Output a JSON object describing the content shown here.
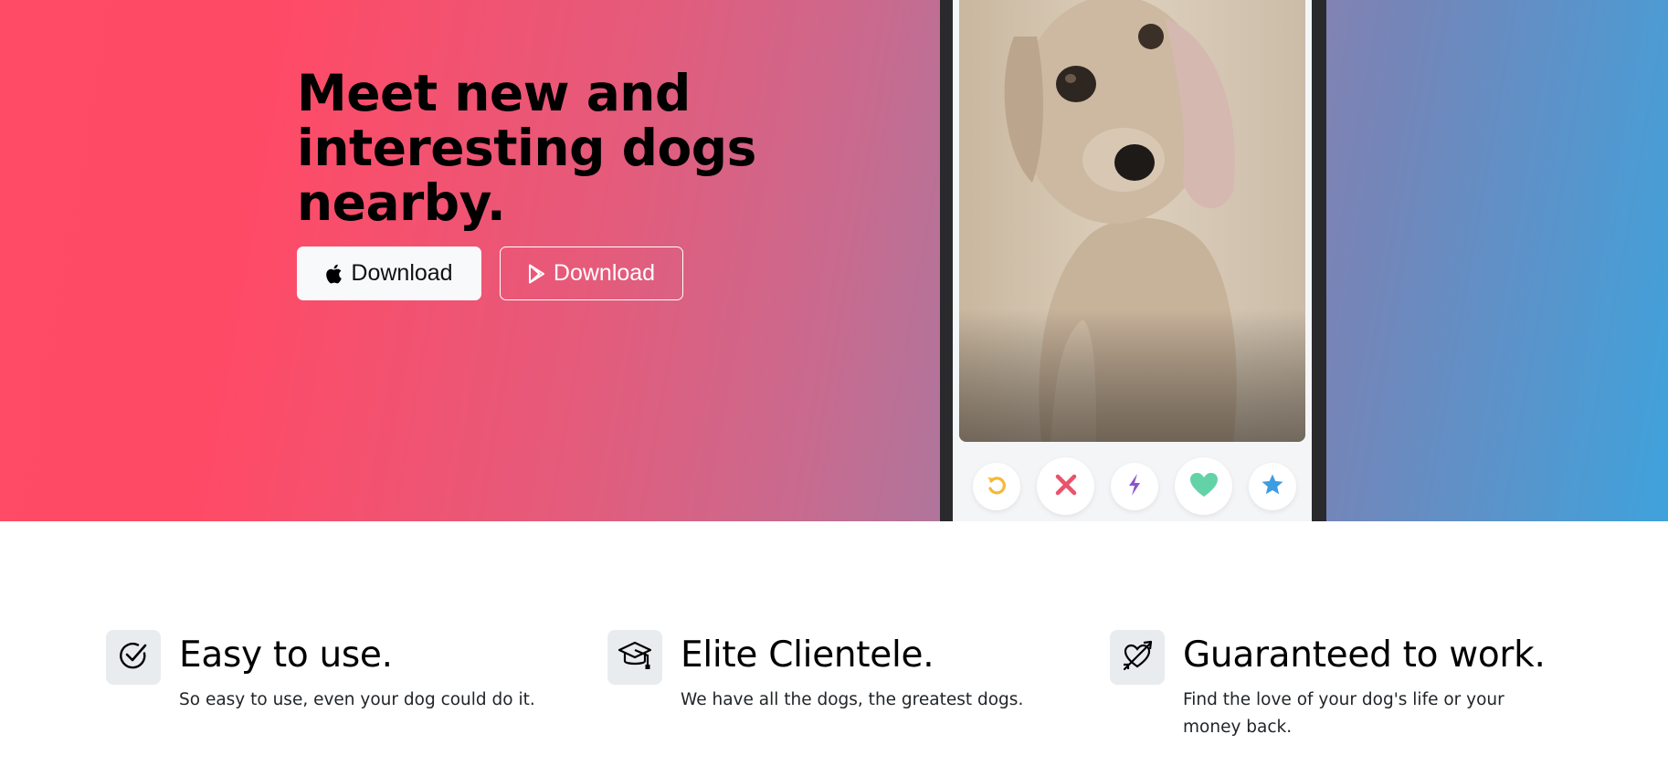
{
  "hero": {
    "headline": "Meet new and interesting dogs nearby.",
    "buttons": {
      "apple_label": "Download",
      "play_label": "Download"
    },
    "colors": {
      "gradient_start": "#ff4a66",
      "gradient_end": "#3fa2dc"
    }
  },
  "phone": {
    "actions": [
      {
        "icon": "undo-icon",
        "color": "#f5b935"
      },
      {
        "icon": "close-icon",
        "color": "#e8546b"
      },
      {
        "icon": "bolt-icon",
        "color": "#8b55c9"
      },
      {
        "icon": "heart-icon",
        "color": "#63d2a7"
      },
      {
        "icon": "star-icon",
        "color": "#3d9de2"
      }
    ]
  },
  "features": [
    {
      "icon": "check-circle-icon",
      "title": "Easy to use.",
      "text": "So easy to use, even your dog could do it."
    },
    {
      "icon": "graduation-cap-icon",
      "title": "Elite Clientele.",
      "text": "We have all the dogs, the greatest dogs."
    },
    {
      "icon": "heart-arrow-icon",
      "title": "Guaranteed to work.",
      "text": "Find the love of your dog's life or your money back."
    }
  ]
}
